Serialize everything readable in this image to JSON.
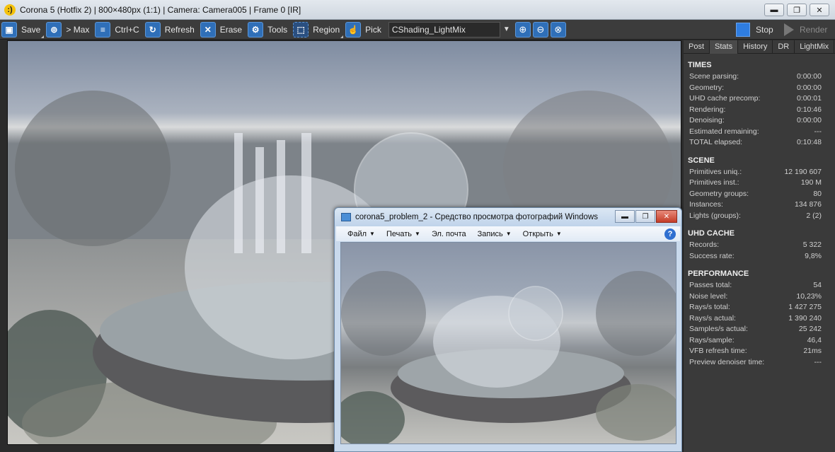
{
  "window": {
    "title": "Corona 5 (Hotfix 2) | 800×480px (1:1) | Camera: Camera005 | Frame 0 [IR]",
    "logo_glyph": ":)"
  },
  "window_controls": {
    "minimize": "▬",
    "restore": "❐",
    "close": "✕"
  },
  "toolbar": {
    "save": "Save",
    "max": "> Max",
    "copy": "Ctrl+C",
    "refresh": "Refresh",
    "erase": "Erase",
    "tools": "Tools",
    "region": "Region",
    "pick": "Pick",
    "lightmix_select": "CShading_LightMix",
    "stop": "Stop",
    "render": "Render"
  },
  "photo_viewer": {
    "title": "corona5_problem_2 - Средство просмотра фотографий Windows",
    "menu": [
      "Файл",
      "Печать",
      "Эл. почта",
      "Запись",
      "Открыть"
    ],
    "help_glyph": "?"
  },
  "panel": {
    "tabs": [
      "Post",
      "Stats",
      "History",
      "DR",
      "LightMix"
    ],
    "active_tab": "Stats",
    "sections": [
      {
        "title": "TIMES",
        "rows": [
          [
            "Scene parsing:",
            "0:00:00"
          ],
          [
            "Geometry:",
            "0:00:00"
          ],
          [
            "UHD cache precomp:",
            "0:00:01"
          ],
          [
            "Rendering:",
            "0:10:46"
          ],
          [
            "Denoising:",
            "0:00:00"
          ],
          [
            "Estimated remaining:",
            "---"
          ],
          [
            "TOTAL elapsed:",
            "0:10:48"
          ]
        ]
      },
      {
        "title": "SCENE",
        "rows": [
          [
            "Primitives uniq.:",
            "12 190 607"
          ],
          [
            "Primitives inst.:",
            "190 M"
          ],
          [
            "Geometry groups:",
            "80"
          ],
          [
            "Instances:",
            "134 876"
          ],
          [
            "Lights (groups):",
            "2 (2)"
          ]
        ]
      },
      {
        "title": "UHD CACHE",
        "rows": [
          [
            "Records:",
            "5 322"
          ],
          [
            "Success rate:",
            "9,8%"
          ]
        ]
      },
      {
        "title": "PERFORMANCE",
        "rows": [
          [
            "Passes total:",
            "54"
          ],
          [
            "Noise level:",
            "10,23%"
          ],
          [
            "Rays/s total:",
            "1 427 275"
          ],
          [
            "Rays/s actual:",
            "1 390 240"
          ],
          [
            "Samples/s actual:",
            "25 242"
          ],
          [
            "Rays/sample:",
            "46,4"
          ],
          [
            "VFB refresh time:",
            "21ms"
          ],
          [
            "Preview denoiser time:",
            "---"
          ]
        ]
      }
    ]
  },
  "colors": {
    "accent": "#2f6fb8",
    "panel_bg": "#3a3a3a",
    "toolbar_bg": "#3c3c3c"
  }
}
